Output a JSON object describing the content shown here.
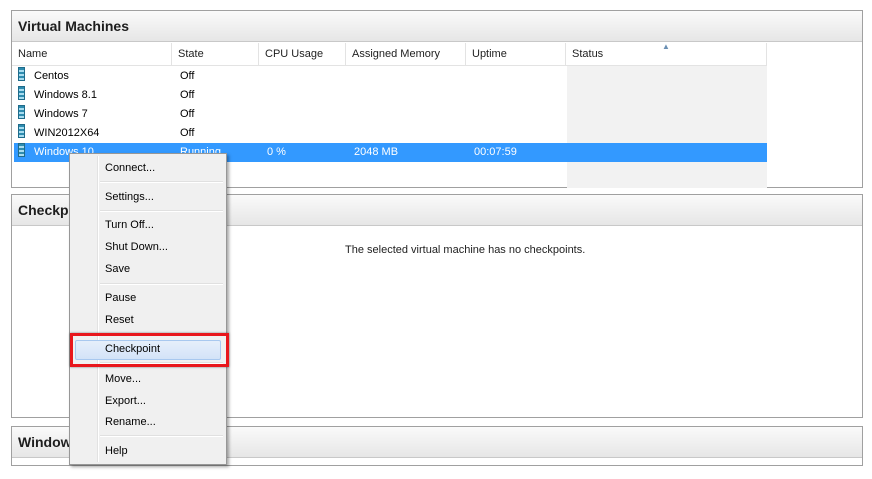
{
  "vm_panel": {
    "title": "Virtual Machines",
    "columns": [
      "Name",
      "State",
      "CPU Usage",
      "Assigned Memory",
      "Uptime",
      "Status"
    ],
    "rows": [
      {
        "name": "Centos",
        "state": "Off",
        "cpu": "",
        "memory": "",
        "uptime": ""
      },
      {
        "name": "Windows 8.1",
        "state": "Off",
        "cpu": "",
        "memory": "",
        "uptime": ""
      },
      {
        "name": "Windows 7",
        "state": "Off",
        "cpu": "",
        "memory": "",
        "uptime": ""
      },
      {
        "name": "WIN2012X64",
        "state": "Off",
        "cpu": "",
        "memory": "",
        "uptime": ""
      },
      {
        "name": "Windows 10",
        "state": "Running",
        "cpu": "0 %",
        "memory": "2048 MB",
        "uptime": "00:07:59"
      }
    ]
  },
  "checkpoints_panel": {
    "title": "Checkpoints",
    "message": "The selected virtual machine has no checkpoints."
  },
  "bottom_panel": {
    "title": "Windows 10"
  },
  "context_menu": {
    "items": [
      "Connect...",
      "Settings...",
      "Turn Off...",
      "Shut Down...",
      "Save",
      "Pause",
      "Reset",
      "Checkpoint",
      "Move...",
      "Export...",
      "Rename...",
      "Help"
    ],
    "highlighted": "Checkpoint"
  },
  "colors": {
    "selection": "#3399ff",
    "highlight_box": "#e8161b"
  }
}
